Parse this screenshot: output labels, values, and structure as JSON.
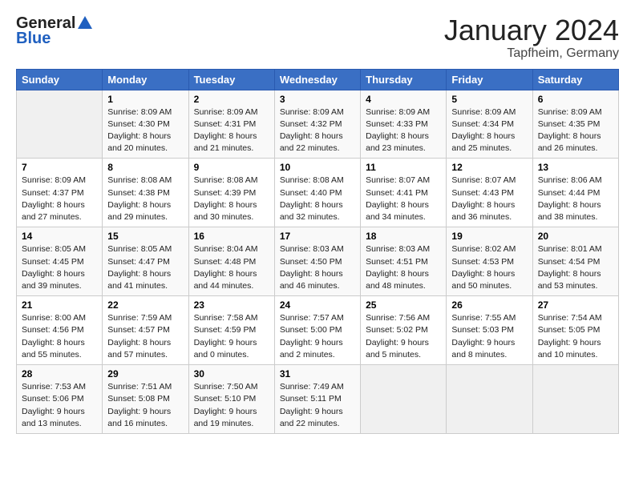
{
  "logo": {
    "general": "General",
    "blue": "Blue"
  },
  "title": "January 2024",
  "subtitle": "Tapfheim, Germany",
  "weekdays": [
    "Sunday",
    "Monday",
    "Tuesday",
    "Wednesday",
    "Thursday",
    "Friday",
    "Saturday"
  ],
  "weeks": [
    [
      {
        "day": "",
        "info": ""
      },
      {
        "day": "1",
        "info": "Sunrise: 8:09 AM\nSunset: 4:30 PM\nDaylight: 8 hours\nand 20 minutes."
      },
      {
        "day": "2",
        "info": "Sunrise: 8:09 AM\nSunset: 4:31 PM\nDaylight: 8 hours\nand 21 minutes."
      },
      {
        "day": "3",
        "info": "Sunrise: 8:09 AM\nSunset: 4:32 PM\nDaylight: 8 hours\nand 22 minutes."
      },
      {
        "day": "4",
        "info": "Sunrise: 8:09 AM\nSunset: 4:33 PM\nDaylight: 8 hours\nand 23 minutes."
      },
      {
        "day": "5",
        "info": "Sunrise: 8:09 AM\nSunset: 4:34 PM\nDaylight: 8 hours\nand 25 minutes."
      },
      {
        "day": "6",
        "info": "Sunrise: 8:09 AM\nSunset: 4:35 PM\nDaylight: 8 hours\nand 26 minutes."
      }
    ],
    [
      {
        "day": "7",
        "info": "Sunrise: 8:09 AM\nSunset: 4:37 PM\nDaylight: 8 hours\nand 27 minutes."
      },
      {
        "day": "8",
        "info": "Sunrise: 8:08 AM\nSunset: 4:38 PM\nDaylight: 8 hours\nand 29 minutes."
      },
      {
        "day": "9",
        "info": "Sunrise: 8:08 AM\nSunset: 4:39 PM\nDaylight: 8 hours\nand 30 minutes."
      },
      {
        "day": "10",
        "info": "Sunrise: 8:08 AM\nSunset: 4:40 PM\nDaylight: 8 hours\nand 32 minutes."
      },
      {
        "day": "11",
        "info": "Sunrise: 8:07 AM\nSunset: 4:41 PM\nDaylight: 8 hours\nand 34 minutes."
      },
      {
        "day": "12",
        "info": "Sunrise: 8:07 AM\nSunset: 4:43 PM\nDaylight: 8 hours\nand 36 minutes."
      },
      {
        "day": "13",
        "info": "Sunrise: 8:06 AM\nSunset: 4:44 PM\nDaylight: 8 hours\nand 38 minutes."
      }
    ],
    [
      {
        "day": "14",
        "info": "Sunrise: 8:05 AM\nSunset: 4:45 PM\nDaylight: 8 hours\nand 39 minutes."
      },
      {
        "day": "15",
        "info": "Sunrise: 8:05 AM\nSunset: 4:47 PM\nDaylight: 8 hours\nand 41 minutes."
      },
      {
        "day": "16",
        "info": "Sunrise: 8:04 AM\nSunset: 4:48 PM\nDaylight: 8 hours\nand 44 minutes."
      },
      {
        "day": "17",
        "info": "Sunrise: 8:03 AM\nSunset: 4:50 PM\nDaylight: 8 hours\nand 46 minutes."
      },
      {
        "day": "18",
        "info": "Sunrise: 8:03 AM\nSunset: 4:51 PM\nDaylight: 8 hours\nand 48 minutes."
      },
      {
        "day": "19",
        "info": "Sunrise: 8:02 AM\nSunset: 4:53 PM\nDaylight: 8 hours\nand 50 minutes."
      },
      {
        "day": "20",
        "info": "Sunrise: 8:01 AM\nSunset: 4:54 PM\nDaylight: 8 hours\nand 53 minutes."
      }
    ],
    [
      {
        "day": "21",
        "info": "Sunrise: 8:00 AM\nSunset: 4:56 PM\nDaylight: 8 hours\nand 55 minutes."
      },
      {
        "day": "22",
        "info": "Sunrise: 7:59 AM\nSunset: 4:57 PM\nDaylight: 8 hours\nand 57 minutes."
      },
      {
        "day": "23",
        "info": "Sunrise: 7:58 AM\nSunset: 4:59 PM\nDaylight: 9 hours\nand 0 minutes."
      },
      {
        "day": "24",
        "info": "Sunrise: 7:57 AM\nSunset: 5:00 PM\nDaylight: 9 hours\nand 2 minutes."
      },
      {
        "day": "25",
        "info": "Sunrise: 7:56 AM\nSunset: 5:02 PM\nDaylight: 9 hours\nand 5 minutes."
      },
      {
        "day": "26",
        "info": "Sunrise: 7:55 AM\nSunset: 5:03 PM\nDaylight: 9 hours\nand 8 minutes."
      },
      {
        "day": "27",
        "info": "Sunrise: 7:54 AM\nSunset: 5:05 PM\nDaylight: 9 hours\nand 10 minutes."
      }
    ],
    [
      {
        "day": "28",
        "info": "Sunrise: 7:53 AM\nSunset: 5:06 PM\nDaylight: 9 hours\nand 13 minutes."
      },
      {
        "day": "29",
        "info": "Sunrise: 7:51 AM\nSunset: 5:08 PM\nDaylight: 9 hours\nand 16 minutes."
      },
      {
        "day": "30",
        "info": "Sunrise: 7:50 AM\nSunset: 5:10 PM\nDaylight: 9 hours\nand 19 minutes."
      },
      {
        "day": "31",
        "info": "Sunrise: 7:49 AM\nSunset: 5:11 PM\nDaylight: 9 hours\nand 22 minutes."
      },
      {
        "day": "",
        "info": ""
      },
      {
        "day": "",
        "info": ""
      },
      {
        "day": "",
        "info": ""
      }
    ]
  ]
}
